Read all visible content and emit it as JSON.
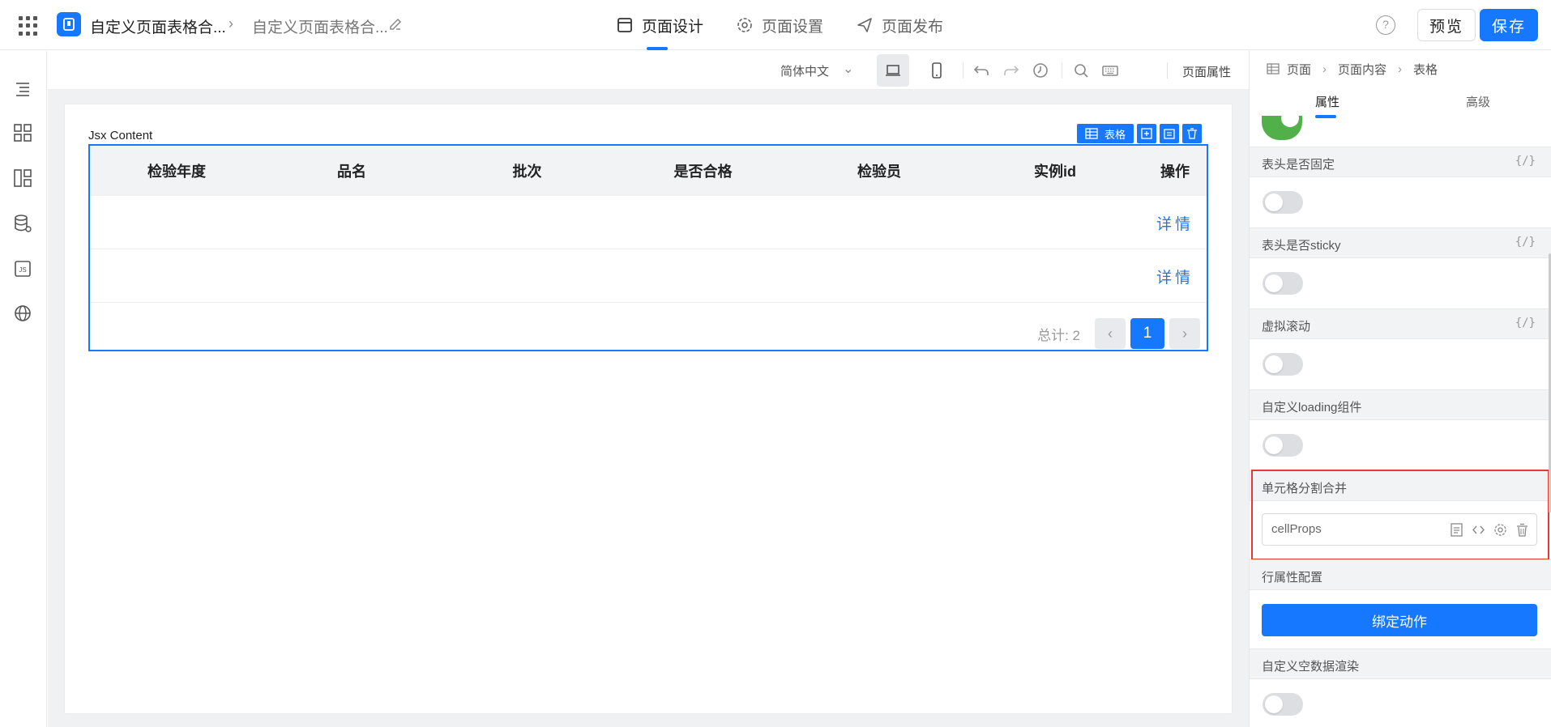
{
  "header": {
    "app_title": "自定义页面表格合...",
    "page_title": "自定义页面表格合...",
    "tabs": [
      {
        "label": "页面设计",
        "icon": "layout-icon",
        "active": true
      },
      {
        "label": "页面设置",
        "icon": "gear-icon",
        "active": false
      },
      {
        "label": "页面发布",
        "icon": "send-icon",
        "active": false
      }
    ],
    "help_label": "?",
    "preview_label": "预览",
    "save_label": "保存"
  },
  "left_rail": {
    "items": [
      "outline-icon",
      "components-icon",
      "layout-icon",
      "datasource-icon",
      "js-icon",
      "globe-icon"
    ]
  },
  "toolbar": {
    "language": "简体中文",
    "page_props_label": "页面属性"
  },
  "canvas": {
    "jsx_label": "Jsx Content",
    "component_tag": "表格",
    "table": {
      "columns": [
        "检验年度",
        "品名",
        "批次",
        "是否合格",
        "检验员",
        "实例id",
        "操作"
      ],
      "rows": [
        {
          "action": "详情"
        },
        {
          "action": "详情"
        }
      ],
      "pagination": {
        "total_text": "总计: 2",
        "current_page": "1",
        "prev": "‹",
        "next": "›"
      }
    }
  },
  "right_panel": {
    "breadcrumb": [
      "页面",
      "页面内容",
      "表格"
    ],
    "tabs": [
      {
        "label": "属性",
        "active": true
      },
      {
        "label": "高级",
        "active": false
      }
    ],
    "sections": [
      {
        "label": "表头是否固定",
        "fx": "{/}",
        "toggle_on": false
      },
      {
        "label": "表头是否sticky",
        "fx": "{/}",
        "toggle_on": false
      },
      {
        "label": "虚拟滚动",
        "fx": "{/}",
        "toggle_on": false
      },
      {
        "label": "自定义loading组件",
        "fx": "",
        "toggle_on": false
      },
      {
        "label": "单元格分割合并",
        "fx": "",
        "input_value": "cellProps"
      },
      {
        "label": "行属性配置",
        "fx": "",
        "button_label": "绑定动作"
      },
      {
        "label": "自定义空数据渲染",
        "fx": "",
        "toggle_on": false
      }
    ]
  },
  "colors": {
    "accent": "#1677ff",
    "highlight": "#e53935",
    "toggle_on": "#52b04a"
  }
}
